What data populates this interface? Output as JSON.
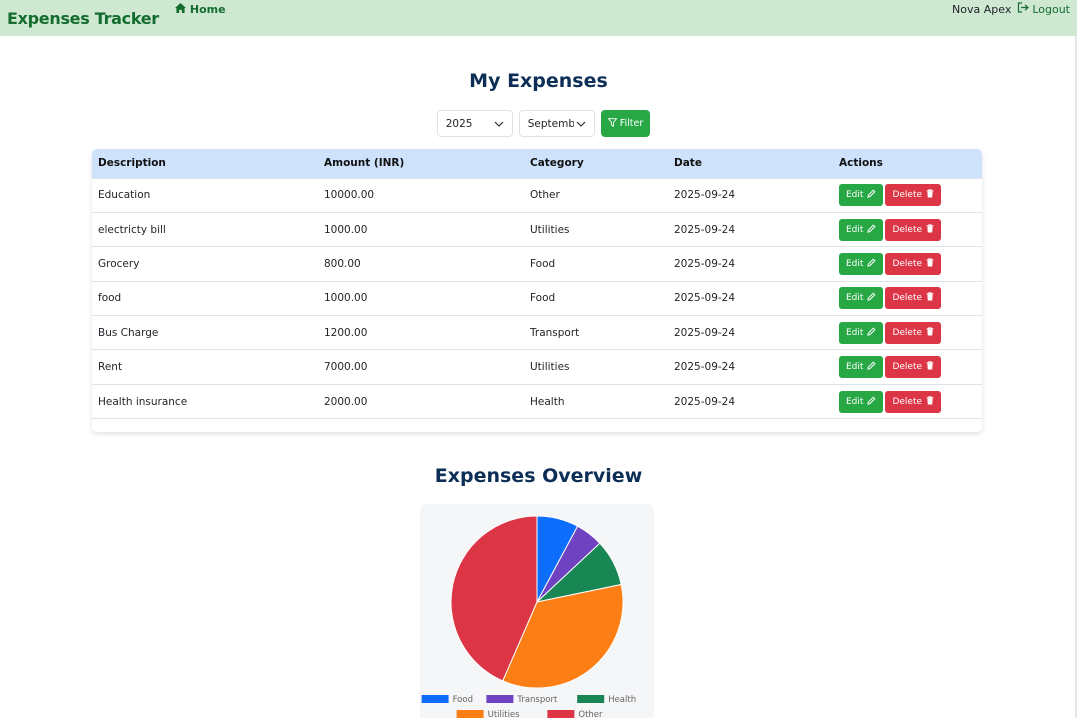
{
  "navbar": {
    "brand": "Expenses Tracker",
    "home_label": "Home",
    "user_name": "Nova Apex",
    "logout_label": "Logout"
  },
  "page": {
    "title": "My Expenses",
    "chart_title": "Expenses Overview"
  },
  "filters": {
    "year": "2025",
    "month": "Septemb",
    "filter_label": "Filter"
  },
  "table": {
    "headers": [
      "Description",
      "Amount (INR)",
      "Category",
      "Date",
      "Actions"
    ],
    "edit_label": "Edit",
    "delete_label": "Delete",
    "rows": [
      {
        "description": "Education",
        "amount": "10000.00",
        "category": "Other",
        "date": "2025-09-24"
      },
      {
        "description": "electricty bill",
        "amount": "1000.00",
        "category": "Utilities",
        "date": "2025-09-24"
      },
      {
        "description": "Grocery",
        "amount": "800.00",
        "category": "Food",
        "date": "2025-09-24"
      },
      {
        "description": "food",
        "amount": "1000.00",
        "category": "Food",
        "date": "2025-09-24"
      },
      {
        "description": "Bus Charge",
        "amount": "1200.00",
        "category": "Transport",
        "date": "2025-09-24"
      },
      {
        "description": "Rent",
        "amount": "7000.00",
        "category": "Utilities",
        "date": "2025-09-24"
      },
      {
        "description": "Health insurance",
        "amount": "2000.00",
        "category": "Health",
        "date": "2025-09-24"
      }
    ]
  },
  "colors": {
    "brand_green": "#146c2e",
    "edit": "#28a745",
    "delete": "#dc3545"
  },
  "chart_data": {
    "type": "pie",
    "categories": [
      "Food",
      "Transport",
      "Health",
      "Utilities",
      "Other"
    ],
    "values": [
      1800,
      1200,
      2000,
      8000,
      10000
    ],
    "colors": [
      "#0d6efd",
      "#6f42c1",
      "#198754",
      "#fd7e14",
      "#dc3545"
    ],
    "legend": "bottom"
  }
}
